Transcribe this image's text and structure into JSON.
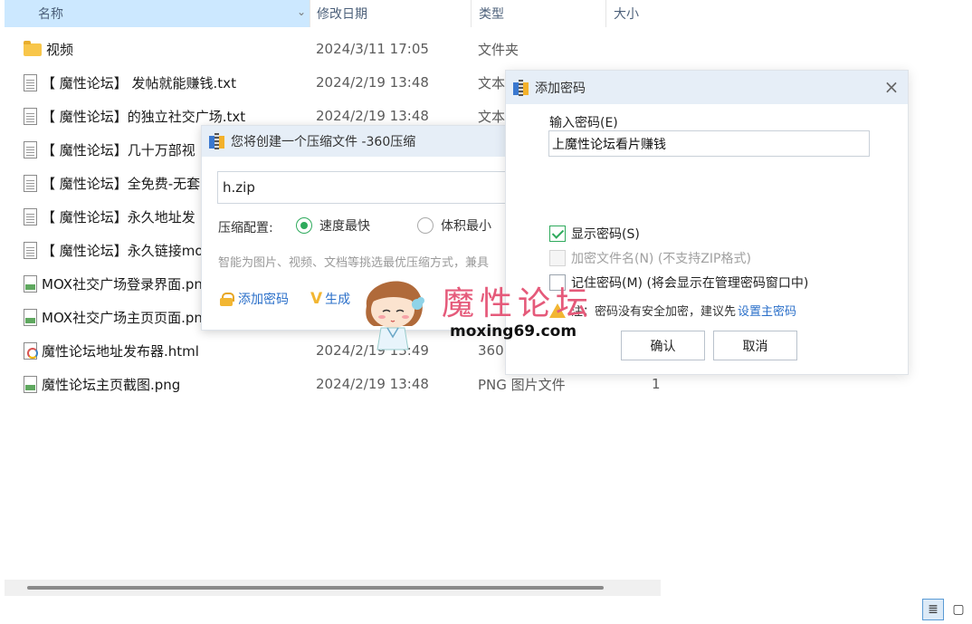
{
  "explorer": {
    "columns": {
      "name": "名称",
      "date": "修改日期",
      "type": "类型",
      "size": "大小"
    },
    "sort_caret": "^",
    "files": [
      {
        "icon": "folder-icon",
        "name": "视频",
        "date": "2024/3/11 17:05",
        "type": "文件夹",
        "size": ""
      },
      {
        "icon": "text-file-icon",
        "name": "【 魔性论坛】 发帖就能赚钱.txt",
        "date": "2024/2/19 13:48",
        "type": "文本",
        "size": ""
      },
      {
        "icon": "text-file-icon",
        "name": "【 魔性论坛】的独立社交广场.txt",
        "date": "2024/2/19 13:48",
        "type": "文本",
        "size": ""
      },
      {
        "icon": "text-file-icon",
        "name": "【 魔性论坛】几十万部视",
        "date": "",
        "type": "",
        "size": ""
      },
      {
        "icon": "text-file-icon",
        "name": "【 魔性论坛】全免费-无套",
        "date": "",
        "type": "",
        "size": ""
      },
      {
        "icon": "text-file-icon",
        "name": "【 魔性论坛】永久地址发",
        "date": "",
        "type": "",
        "size": ""
      },
      {
        "icon": "text-file-icon",
        "name": "【 魔性论坛】永久链接mo",
        "date": "",
        "type": "",
        "size": ""
      },
      {
        "icon": "image-file-icon",
        "name": "MOX社交广场登录界面.pn",
        "date": "",
        "type": "",
        "size": ""
      },
      {
        "icon": "image-file-icon",
        "name": "MOX社交广场主页页面.pn",
        "date": "",
        "type": "",
        "size": ""
      },
      {
        "icon": "html-file-icon",
        "name": "魔性论坛地址发布器.html",
        "date": "2024/2/19 13:49",
        "type": "360",
        "size": ""
      },
      {
        "icon": "image-file-icon",
        "name": "魔性论坛主页截图.png",
        "date": "2024/2/19 13:48",
        "type": "PNG 图片文件",
        "size": "1"
      }
    ]
  },
  "compress_dialog": {
    "title": "您将创建一个压缩文件 -360压缩",
    "filename": "h.zip",
    "config_label": "压缩配置:",
    "option_speed": "速度最快",
    "option_size": "体积最小",
    "selected": "speed",
    "hint": "智能为图片、视频、文档等挑选最优压缩方式，兼具",
    "add_password": "添加密码",
    "generate_prefix": "生成",
    "generate_icon": "V"
  },
  "password_dialog": {
    "title": "添加密码",
    "close": "×",
    "input_label": "输入密码(E)",
    "password_value": "上魔性论坛看片赚钱",
    "show_password": "显示密码(S)",
    "show_password_checked": true,
    "encrypt_names": "加密文件名(N) (不支持ZIP格式)",
    "remember_password": "记住密码(M) (将会显示在管理密码窗口中)",
    "note_text": "注：密码没有安全加密，建议先",
    "note_link": "设置主密码",
    "ok": "确认",
    "cancel": "取消"
  },
  "watermark": {
    "text": "魔性论坛",
    "url": "moxing69.com"
  },
  "view_buttons": {
    "details": "≣",
    "tiles": "▢"
  },
  "colors": {
    "header_selected": "#cce8ff",
    "dialog_title_bg": "#e6eef7",
    "accent_green": "#2eaa5c",
    "link_blue": "#2a6fc9",
    "watermark_pink": "#e55a7a"
  }
}
